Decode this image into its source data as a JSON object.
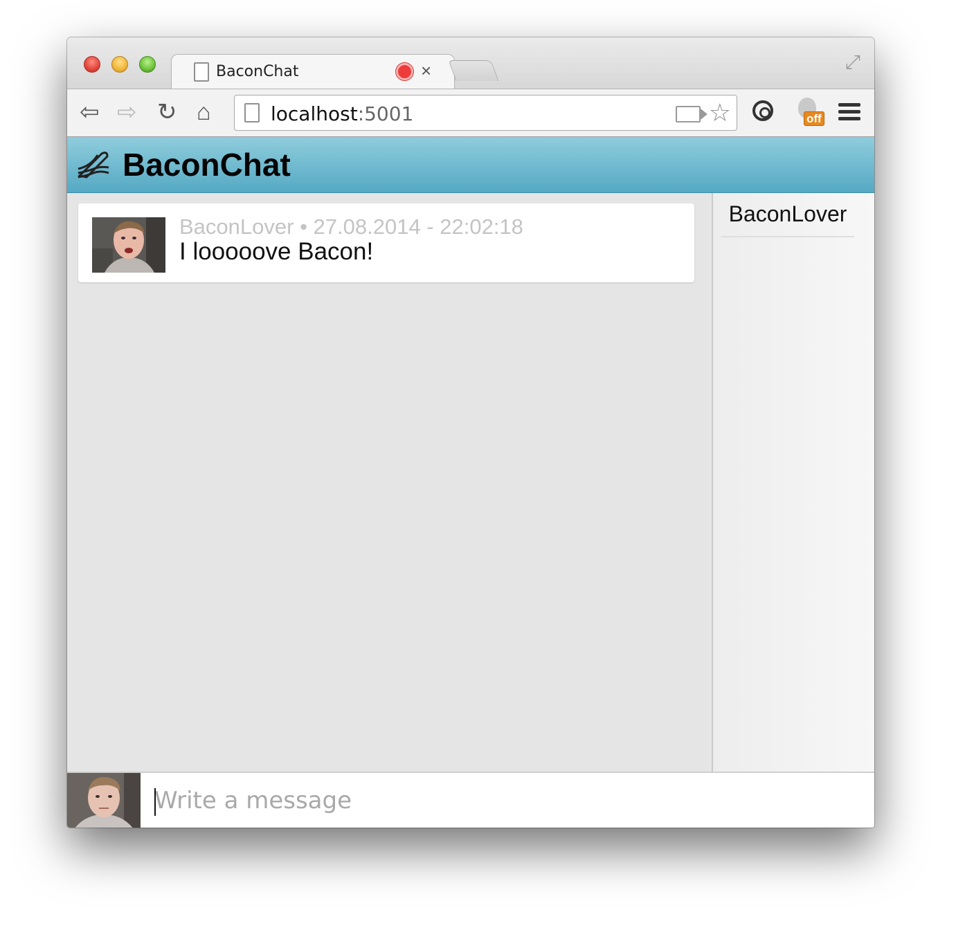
{
  "browser": {
    "tab_title": "BaconChat",
    "url_host": "localhost",
    "url_port": ":5001",
    "extension_badge": "off"
  },
  "app": {
    "title": "BaconChat"
  },
  "messages": [
    {
      "author": "BaconLover",
      "separator": " • ",
      "timestamp": "27.08.2014 - 22:02:18",
      "text": "I looooove Bacon!"
    }
  ],
  "users": [
    "BaconLover"
  ],
  "composer": {
    "placeholder": "Write a message"
  },
  "colors": {
    "header_top": "#8fcddc",
    "header_bottom": "#55a9c4",
    "record_red": "#ee3b3b",
    "badge_orange": "#e8891e"
  },
  "icons": [
    "close-icon",
    "minimize-icon",
    "zoom-icon",
    "page-icon",
    "record-icon",
    "tab-close-icon",
    "fullscreen-icon",
    "back-arrow-icon",
    "forward-arrow-icon",
    "reload-icon",
    "home-icon",
    "camera-icon",
    "star-icon",
    "sync-icon",
    "fire-extension-icon",
    "menu-icon",
    "bacon-logo-icon"
  ]
}
